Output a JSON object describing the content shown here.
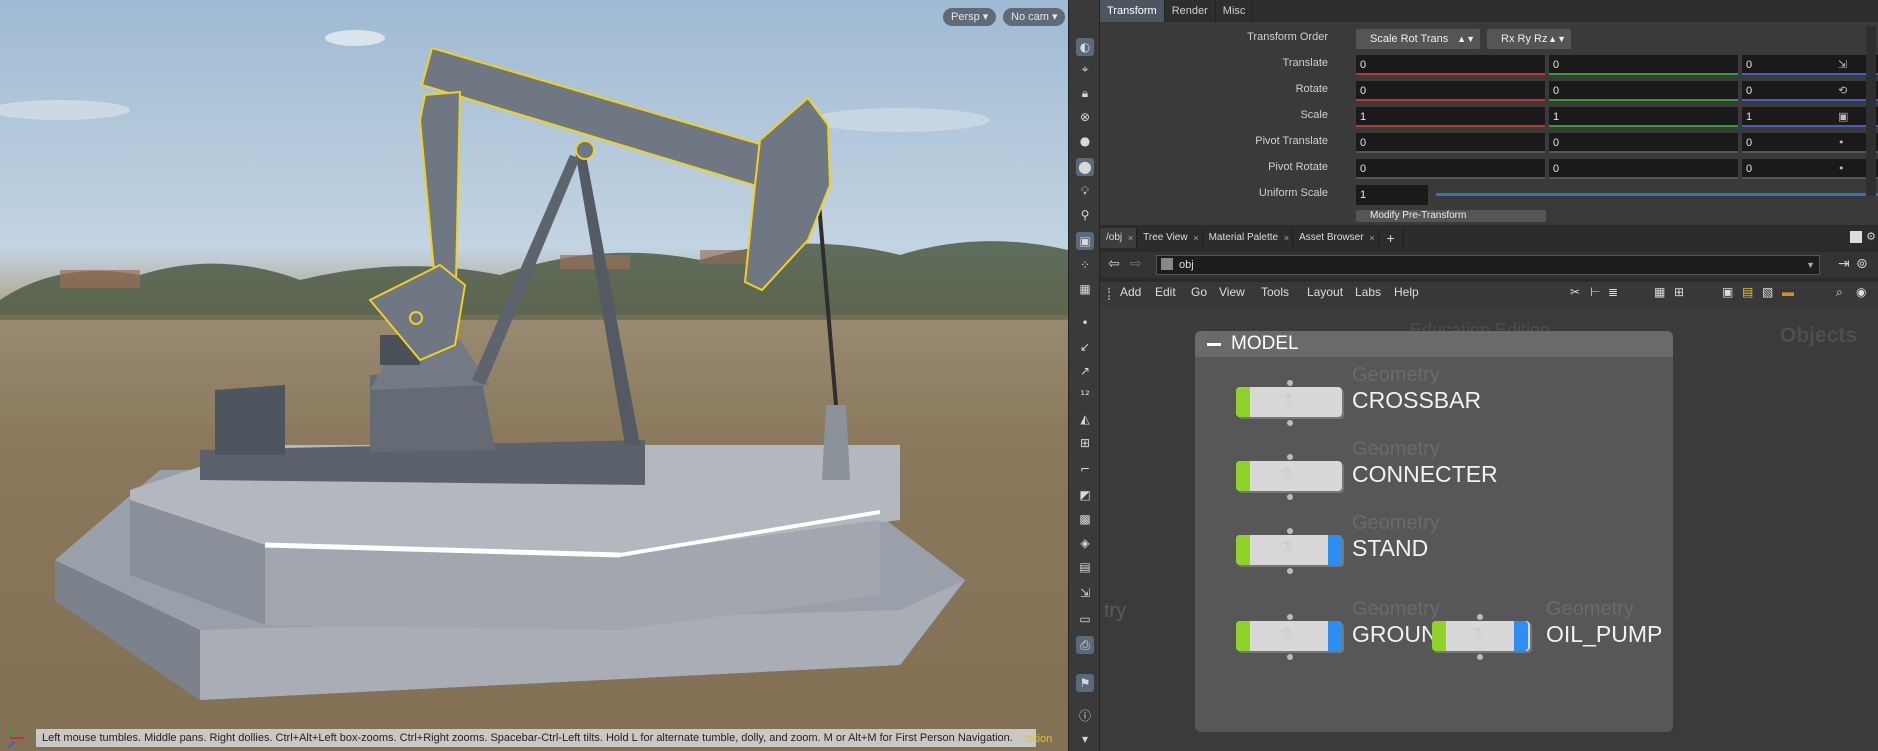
{
  "viewport": {
    "persp_label": "Persp",
    "cam_label": "No cam",
    "status_text": "Left mouse tumbles. Middle pans. Right dollies. Ctrl+Alt+Left box-zooms. Ctrl+Right zooms. Spacebar-Ctrl-Left tilts. Hold L for alternate tumble, dolly, and zoom.     M or Alt+M for First Person Navigation.",
    "status_tail": "dition"
  },
  "params": {
    "tabs": [
      "Transform",
      "Render",
      "Misc"
    ],
    "transform_order_label": "Transform Order",
    "transform_order_value": "Scale Rot Trans",
    "rotate_order_value": "Rx Ry Rz",
    "rows": [
      {
        "label": "Translate",
        "values": [
          "0",
          "0",
          "0"
        ]
      },
      {
        "label": "Rotate",
        "values": [
          "0",
          "0",
          "0"
        ]
      },
      {
        "label": "Scale",
        "values": [
          "1",
          "1",
          "1"
        ]
      },
      {
        "label": "Pivot Translate",
        "values": [
          "0",
          "0",
          "0"
        ]
      },
      {
        "label": "Pivot Rotate",
        "values": [
          "0",
          "0",
          "0"
        ]
      }
    ],
    "uniform_scale_label": "Uniform Scale",
    "uniform_scale_value": "1",
    "uniform_scale_level": 1.0,
    "cut_off_button": "Modify Pre-Transform"
  },
  "network_tabs": [
    {
      "label": "/obj"
    },
    {
      "label": "Tree View"
    },
    {
      "label": "Material Palette"
    },
    {
      "label": "Asset Browser"
    }
  ],
  "path": {
    "value": "obj"
  },
  "menu": [
    "Add",
    "Edit",
    "Go",
    "View",
    "Tools",
    "Layout",
    "Labs",
    "Help"
  ],
  "network": {
    "watermark_edition": "Education Edition",
    "watermark_context": "Objects",
    "watermark_left": "try",
    "box_title": "MODEL",
    "nodes": [
      {
        "type": "Geometry",
        "name": "CROSSBAR",
        "blue_flag": false
      },
      {
        "type": "Geometry",
        "name": "CONNECTER",
        "blue_flag": false
      },
      {
        "type": "Geometry",
        "name": "STAND",
        "blue_flag": true
      },
      {
        "type": "Geometry",
        "name": "GROUN",
        "blue_flag": true
      },
      {
        "type": "Geometry",
        "name": "OIL_PUMP",
        "blue_flag": true
      }
    ]
  },
  "colors": {
    "selection": "#f0d020",
    "x_axis": "#b33b3b",
    "y_axis": "#3a9a3a",
    "z_axis": "#4a5bc0",
    "display_flag": "#8fd32a",
    "render_flag": "#2b8ef0"
  }
}
